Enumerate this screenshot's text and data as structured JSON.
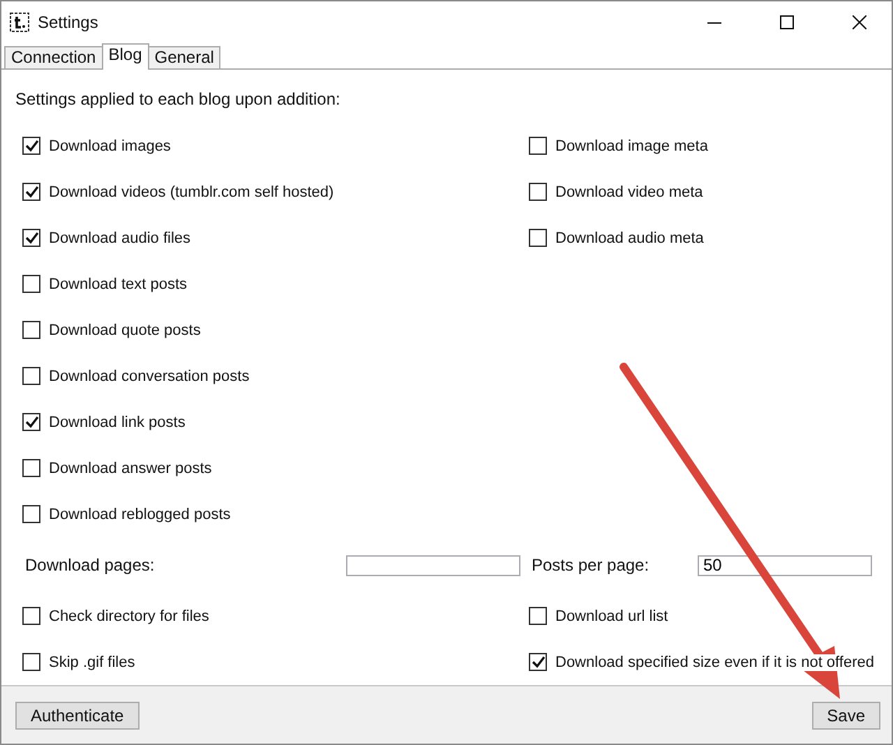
{
  "window": {
    "title": "Settings"
  },
  "tabs": [
    {
      "label": "Connection",
      "selected": false
    },
    {
      "label": "Blog",
      "selected": true
    },
    {
      "label": "General",
      "selected": false
    }
  ],
  "heading": "Settings applied to each blog upon addition:",
  "options_left": [
    {
      "label": "Download images",
      "checked": true
    },
    {
      "label": "Download videos (tumblr.com self hosted)",
      "checked": true
    },
    {
      "label": "Download audio files",
      "checked": true
    },
    {
      "label": "Download text posts",
      "checked": false
    },
    {
      "label": "Download quote posts",
      "checked": false
    },
    {
      "label": "Download conversation posts",
      "checked": false
    },
    {
      "label": "Download link posts",
      "checked": true
    },
    {
      "label": "Download answer posts",
      "checked": false
    },
    {
      "label": "Download reblogged posts",
      "checked": false
    }
  ],
  "options_right": [
    {
      "label": "Download image meta",
      "checked": false
    },
    {
      "label": "Download video meta",
      "checked": false
    },
    {
      "label": "Download audio meta",
      "checked": false
    }
  ],
  "fields": [
    {
      "label": "Download pages:"
    },
    {
      "label": "Posts per page:",
      "value": "50"
    }
  ],
  "extra_options": [
    {
      "label": "Check directory for files",
      "checked": false
    },
    {
      "label": "Download url list",
      "checked": false
    },
    {
      "label": "Skip .gif files",
      "checked": false
    },
    {
      "label": "Download specified size even if it is not offered",
      "checked": true
    }
  ],
  "buttons": [
    {
      "label": "Authenticate"
    },
    {
      "label": "Save"
    }
  ]
}
